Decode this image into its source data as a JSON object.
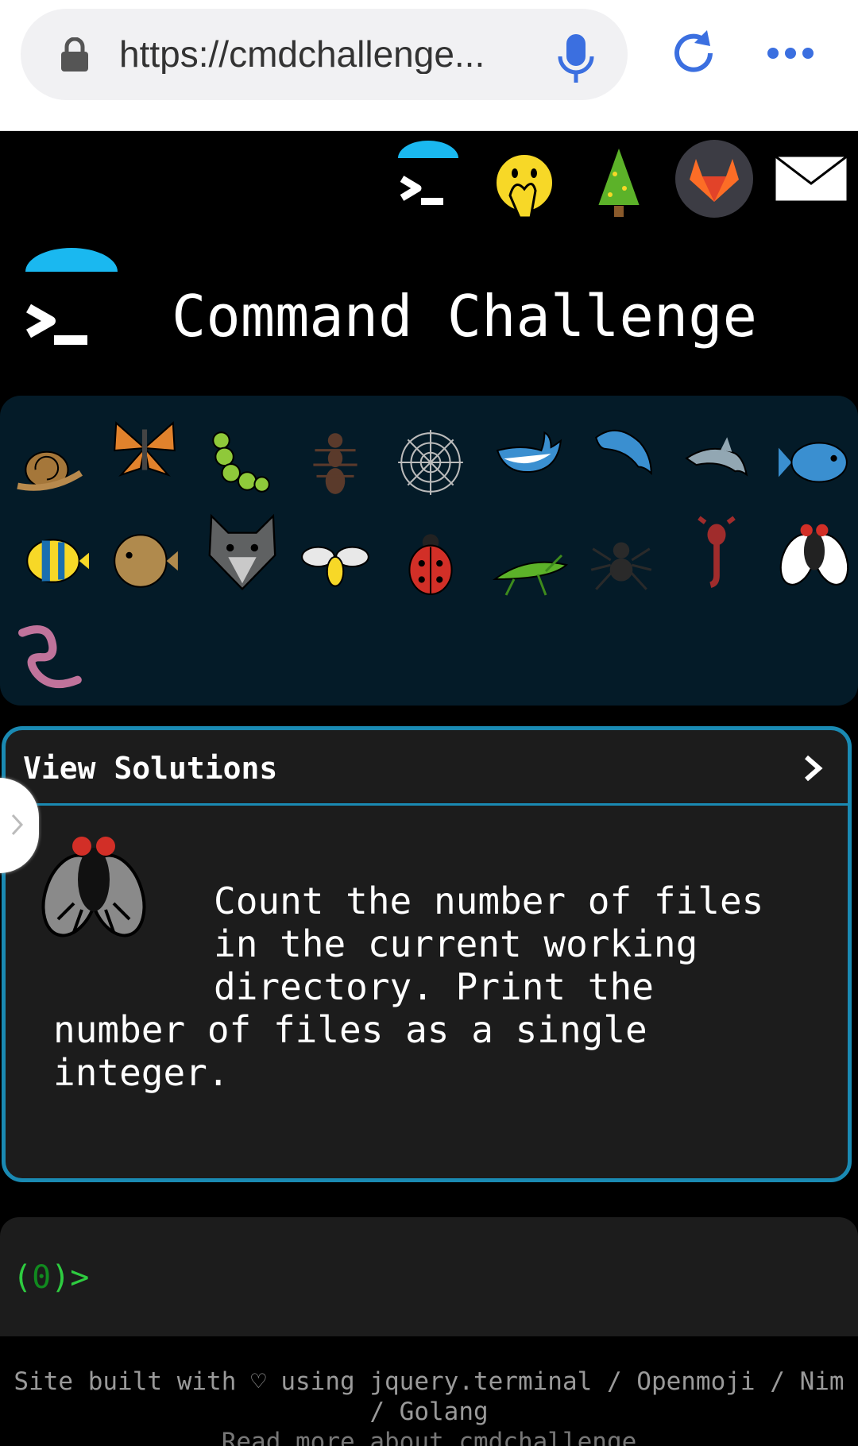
{
  "browser": {
    "url": "https://cmdchallenge...",
    "icons": [
      "lock-icon",
      "microphone-icon",
      "reload-icon",
      "more-options-icon"
    ],
    "accent": "#3b6fe0"
  },
  "topnav": {
    "icons": [
      "cmdchallenge-logo-icon",
      "face-with-hand-over-mouth-icon",
      "christmas-tree-icon",
      "gitlab-icon",
      "envelope-icon"
    ]
  },
  "header": {
    "title": "Command Challenge"
  },
  "creatures": [
    "snail",
    "butterfly",
    "caterpillar",
    "ant",
    "spider-web",
    "whale",
    "dolphin-blue",
    "dolphin",
    "fish",
    "tropical-fish",
    "pufferfish",
    "wolf",
    "bee",
    "ladybug",
    "cricket",
    "spider",
    "scorpion",
    "fly",
    "worm"
  ],
  "panel": {
    "title": "View Solutions",
    "challenge_text": "Count the number of files\nin the current working\ndirectory. Print the",
    "challenge_text_2": "number of files as a single\ninteger."
  },
  "terminal": {
    "prompt_open": "(",
    "prompt_count": "0",
    "prompt_close": ")>"
  },
  "footer": {
    "text": "Site built with ♡ using jquery.terminal / Openmoji / Nim / Golang",
    "more": "Read more about cmdchallenge"
  },
  "colors": {
    "panel_border": "#1a8ab3",
    "prompt_green": "#2ecc40",
    "grid_bg": "#041b28"
  }
}
